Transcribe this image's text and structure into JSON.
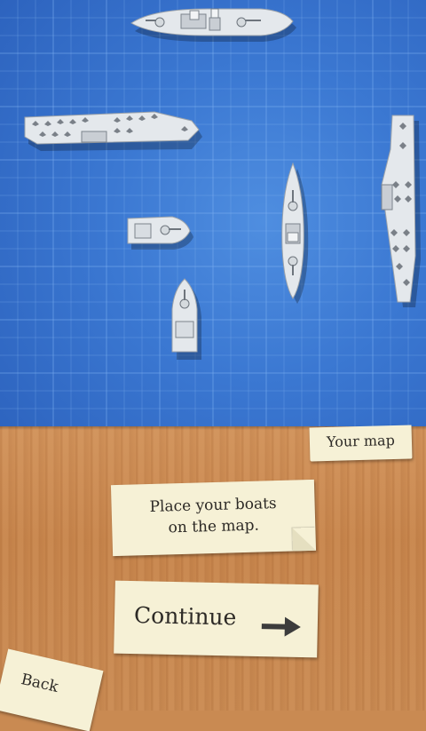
{
  "board": {
    "colors": {
      "sea": "#3b78d2",
      "grid_line": "#6fa5ea"
    }
  },
  "ships": [
    {
      "name": "battleship",
      "orientation": "horizontal",
      "placed": true
    },
    {
      "name": "aircraft-carrier",
      "orientation": "horizontal",
      "placed": true
    },
    {
      "name": "patrol-boat",
      "orientation": "horizontal",
      "placed": true
    },
    {
      "name": "submarine",
      "orientation": "vertical",
      "placed": true
    },
    {
      "name": "destroyer",
      "orientation": "vertical",
      "placed": true
    },
    {
      "name": "aircraft-carrier-2",
      "orientation": "vertical",
      "placed": true
    }
  ],
  "tabs": {
    "your_map": "Your map"
  },
  "instructions": {
    "text": "Place your boats\non the map."
  },
  "buttons": {
    "continue": "Continue",
    "back": "Back",
    "continue_icon": "arrow-right-icon"
  },
  "colors": {
    "paper": "#f6f1d6",
    "wood": "#c98a52",
    "text": "#2d2a26"
  }
}
